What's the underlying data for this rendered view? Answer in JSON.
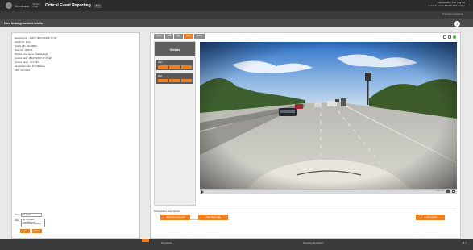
{
  "app": {
    "logo_text": "Omnitracs",
    "brand_small_line1": "Services",
    "brand_small_line2": "Portal",
    "title": "Critical Event Reporting",
    "title_badge": "Beta",
    "top_right_line1": "Administrator | Help | Log Out",
    "top_right_line2": "Customer Service 800-000-0000 Settings",
    "subbar_right": "Critical Event Reporting"
  },
  "header": {
    "title": "Hard braking incident details",
    "help_symbol": "?"
  },
  "details": [
    "Document No. : 10476 / 08/17/2016 17:07:46",
    "Vehicle ID : 1122",
    "Vehicle VIN : 1FUJ3B16...",
    "Driver ID : 1029741",
    "Positive driver status : Not assigned",
    "Incident Date : 08/16/2016 07:17:37 AM",
    "Incident speed : 44.5 MPH",
    "Deceleration rate : 11.0 MPH/sec",
    "ARS : Not Active"
  ],
  "left_bottom": {
    "view_label": "View",
    "view_value": "Reviewed",
    "also_label": "Also",
    "also_items": [
      "Not Coachable",
      "Coachable event",
      "Event needs Reviewing"
    ],
    "save_label": "Save",
    "cancel_label": "Cancel"
  },
  "tabs": [
    "Graph",
    "Grid",
    "Map",
    "Video",
    "History"
  ],
  "active_tab": "Video",
  "videos": {
    "header": "Videos",
    "cameras": [
      "Front",
      "Rear"
    ]
  },
  "player": {
    "time": "0:00 / 0:12"
  },
  "navigation": {
    "label": "Previous/Next Event Review",
    "prev_label": "◀ Previous Report",
    "next_label": "Next Report ▶",
    "download_label": "⬇ Download"
  },
  "footer": {
    "text1": "All Incidents",
    "text2": "Reviewing All Incidents",
    "icons": "⚙ ?"
  },
  "colors": {
    "accent": "#f0801f",
    "dark": "#2b2b2b"
  }
}
